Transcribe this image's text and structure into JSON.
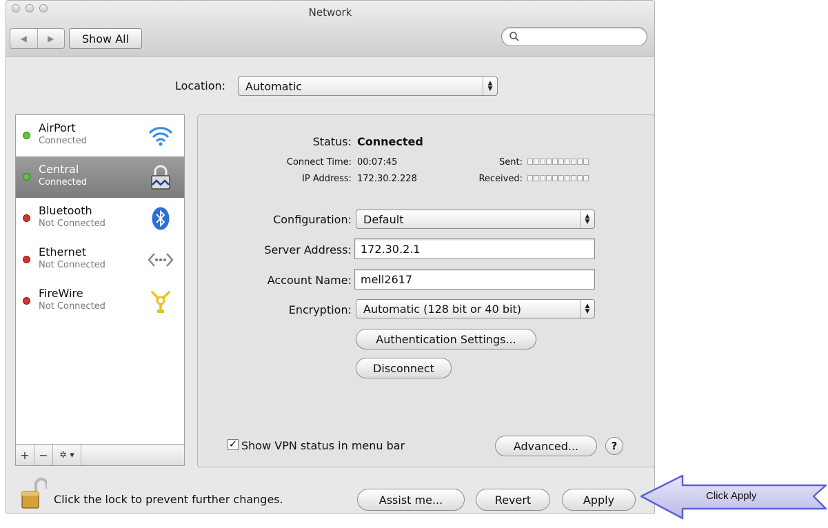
{
  "window": {
    "title": "Network"
  },
  "toolbar": {
    "back_glyph": "◀",
    "forward_glyph": "▶",
    "show_all_label": "Show All",
    "search_placeholder": ""
  },
  "location": {
    "label": "Location:",
    "value": "Automatic"
  },
  "sidebar": {
    "items": [
      {
        "name": "AirPort",
        "status": "Connected",
        "dot_color": "#5fc23b",
        "icon": "wifi-icon",
        "selected": false
      },
      {
        "name": "Central",
        "status": "Connected",
        "dot_color": "#5fc23b",
        "icon": "vpn-lock-icon",
        "selected": true
      },
      {
        "name": "Bluetooth",
        "status": "Not Connected",
        "dot_color": "#d6302a",
        "icon": "bluetooth-icon",
        "selected": false
      },
      {
        "name": "Ethernet",
        "status": "Not Connected",
        "dot_color": "#d6302a",
        "icon": "ethernet-icon",
        "selected": false
      },
      {
        "name": "FireWire",
        "status": "Not Connected",
        "dot_color": "#d6302a",
        "icon": "firewire-icon",
        "selected": false
      }
    ],
    "footer": {
      "add": "+",
      "remove": "−",
      "gear": "✲ ▾"
    }
  },
  "detail": {
    "status_label": "Status:",
    "status_value": "Connected",
    "connect_time_label": "Connect Time:",
    "connect_time_value": "00:07:45",
    "ip_label": "IP Address:",
    "ip_value": "172.30.2.228",
    "sent_label": "Sent:",
    "received_label": "Received:",
    "configuration_label": "Configuration:",
    "configuration_value": "Default",
    "server_label": "Server Address:",
    "server_value": "172.30.2.1",
    "account_label": "Account Name:",
    "account_value": "mell2617",
    "encryption_label": "Encryption:",
    "encryption_value": "Automatic (128 bit or 40 bit)",
    "auth_button": "Authentication Settings...",
    "disconnect_button": "Disconnect",
    "show_vpn_label": "Show VPN status in menu bar",
    "show_vpn_checked": "✓",
    "advanced_button": "Advanced...",
    "help_label": "?"
  },
  "bottom": {
    "lock_text": "Click the lock to prevent further changes.",
    "assist_button": "Assist me...",
    "revert_button": "Revert",
    "apply_button": "Apply"
  },
  "callout": {
    "text": "Click Apply",
    "color": "#6f6fe0"
  }
}
